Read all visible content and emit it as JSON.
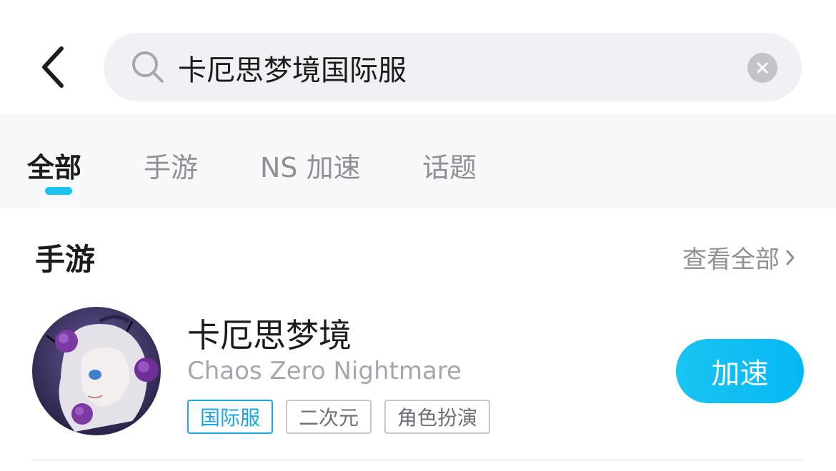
{
  "search": {
    "query": "卡厄思梦境国际服"
  },
  "tabs": [
    {
      "label": "全部",
      "active": true
    },
    {
      "label": "手游",
      "active": false
    },
    {
      "label": "NS 加速",
      "active": false
    },
    {
      "label": "话题",
      "active": false
    }
  ],
  "section": {
    "title": "手游",
    "see_all_label": "查看全部"
  },
  "game": {
    "name": "卡厄思梦境",
    "english_name": "Chaos Zero Nightmare",
    "tags": [
      "国际服",
      "二次元",
      "角色扮演"
    ],
    "action_label": "加速"
  },
  "colors": {
    "accent": "#19c4f1",
    "tag_accent": "#19a8e0",
    "search_bg": "#f0f1f4",
    "tabs_bg": "#f7f8fa"
  },
  "icons": {
    "back": "chevron-left-icon",
    "search": "search-icon",
    "clear": "close-icon",
    "see_all": "chevron-right-icon"
  }
}
